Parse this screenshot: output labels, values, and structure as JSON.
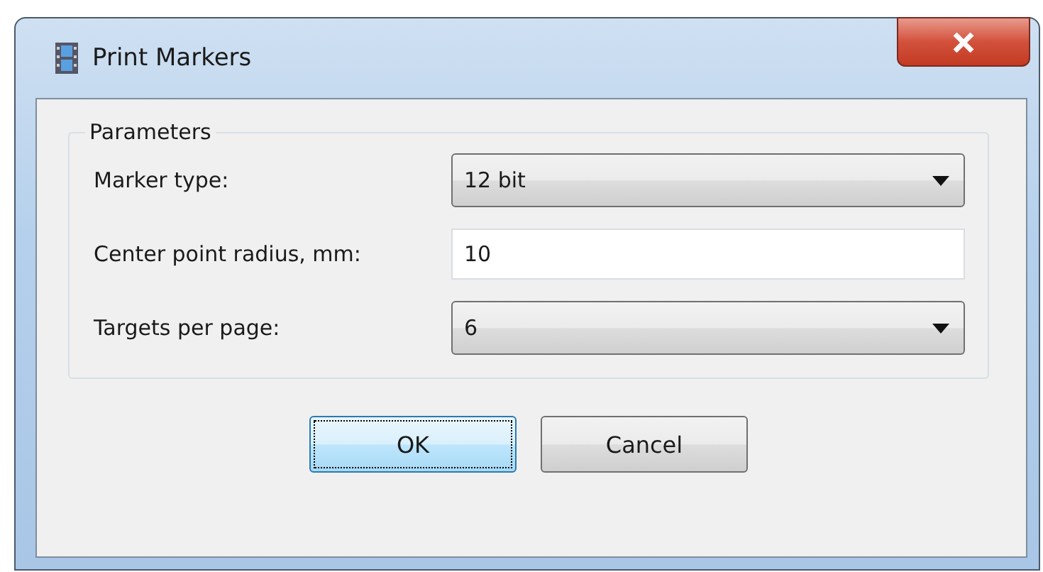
{
  "window": {
    "title": "Print Markers"
  },
  "group": {
    "title": "Parameters"
  },
  "fields": [
    {
      "label": "Marker type:",
      "kind": "dropdown",
      "value": "12 bit"
    },
    {
      "label": "Center point radius, mm:",
      "kind": "text",
      "value": "10"
    },
    {
      "label": "Targets per page:",
      "kind": "dropdown",
      "value": "6"
    }
  ],
  "buttons": [
    {
      "label": "OK",
      "focused": true
    },
    {
      "label": "Cancel",
      "focused": false
    }
  ]
}
